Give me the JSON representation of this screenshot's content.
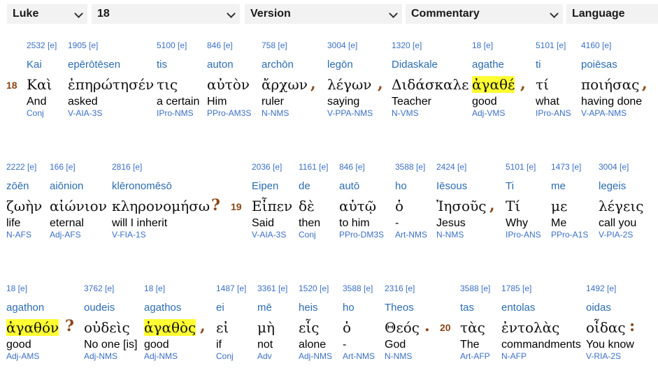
{
  "toolbar": {
    "book": "Luke",
    "chapter": "18",
    "version": "Version",
    "commentary": "Commentary",
    "language": "Language"
  },
  "verses": {
    "v18": "18",
    "v19": "19",
    "v20": "20"
  },
  "punctuation": {
    "p1": ",",
    "p2": ",",
    "p3": ",",
    "p4": ",",
    "p5": "?",
    "p6": ",",
    "p7": "?",
    "p8": ",",
    "p9": ".",
    "p10": ":"
  },
  "words": [
    {
      "strong": "2532 [e]",
      "translit": "Kai",
      "greek": "Καὶ",
      "english": "And",
      "morph": "Conj"
    },
    {
      "strong": "1905 [e]",
      "translit": "epērōtēsen",
      "greek": "ἐπηρώτησέν",
      "english": "asked",
      "morph": "V-AIA-3S"
    },
    {
      "strong": "5100 [e]",
      "translit": "tis",
      "greek": "τις",
      "english": "a certain",
      "morph": "IPro-NMS"
    },
    {
      "strong": "846 [e]",
      "translit": "auton",
      "greek": "αὐτὸν",
      "english": "Him",
      "morph": "PPro-AM3S"
    },
    {
      "strong": "758 [e]",
      "translit": "archōn",
      "greek": "ἄρχων",
      "english": "ruler",
      "morph": "N-NMS"
    },
    {
      "strong": "3004 [e]",
      "translit": "legōn",
      "greek": "λέγων",
      "english": "saying",
      "morph": "V-PPA-NMS"
    },
    {
      "strong": "1320 [e]",
      "translit": "Didaskale",
      "greek": "Διδάσκαλε",
      "english": "Teacher",
      "morph": "N-VMS"
    },
    {
      "strong": "18 [e]",
      "translit": "agathe",
      "greek": "ἀγαθέ",
      "english": "good",
      "morph": "Adj-VMS",
      "highlight": true
    },
    {
      "strong": "5101 [e]",
      "translit": "ti",
      "greek": "τί",
      "english": "what",
      "morph": "IPro-ANS"
    },
    {
      "strong": "4160 [e]",
      "translit": "poiēsas",
      "greek": "ποιήσας",
      "english": "having done",
      "morph": "V-APA-NMS"
    },
    {
      "strong": "2222 [e]",
      "translit": "zōēn",
      "greek": "ζωὴν",
      "english": "life",
      "morph": "N-AFS"
    },
    {
      "strong": "166 [e]",
      "translit": "aiōnion",
      "greek": "αἰώνιον",
      "english": "eternal",
      "morph": "Adj-AFS"
    },
    {
      "strong": "2816 [e]",
      "translit": "klēronomēsō",
      "greek": "κληρονομήσω",
      "english": "will I inherit",
      "morph": "V-FIA-1S"
    },
    {
      "strong": "2036 [e]",
      "translit": "Eipen",
      "greek": "Εἶπεν",
      "english": "Said",
      "morph": "V-AIA-3S"
    },
    {
      "strong": "1161 [e]",
      "translit": "de",
      "greek": "δὲ",
      "english": "then",
      "morph": "Conj"
    },
    {
      "strong": "846 [e]",
      "translit": "autō",
      "greek": "αὐτῷ",
      "english": "to him",
      "morph": "PPro-DM3S"
    },
    {
      "strong": "3588 [e]",
      "translit": "ho",
      "greek": "ὁ",
      "english": "-",
      "morph": "Art-NMS"
    },
    {
      "strong": "2424 [e]",
      "translit": "Iēsous",
      "greek": "Ἰησοῦς",
      "english": "Jesus",
      "morph": "N-NMS"
    },
    {
      "strong": "5101 [e]",
      "translit": "Ti",
      "greek": "Τί",
      "english": "Why",
      "morph": "IPro-ANS"
    },
    {
      "strong": "1473 [e]",
      "translit": "me",
      "greek": "με",
      "english": "Me",
      "morph": "PPro-A1S"
    },
    {
      "strong": "3004 [e]",
      "translit": "legeis",
      "greek": "λέγεις",
      "english": "call you",
      "morph": "V-PIA-2S"
    },
    {
      "strong": "18 [e]",
      "translit": "agathon",
      "greek": "ἀγαθόν",
      "english": "good",
      "morph": "Adj-AMS",
      "highlight": true
    },
    {
      "strong": "3762 [e]",
      "translit": "oudeis",
      "greek": "οὐδεὶς",
      "english": "No one [is]",
      "morph": "Adj-NMS"
    },
    {
      "strong": "18 [e]",
      "translit": "agathos",
      "greek": "ἀγαθὸς",
      "english": "good",
      "morph": "Adj-NMS",
      "highlight": true
    },
    {
      "strong": "1487 [e]",
      "translit": "ei",
      "greek": "εἰ",
      "english": "if",
      "morph": "Conj"
    },
    {
      "strong": "3361 [e]",
      "translit": "mē",
      "greek": "μὴ",
      "english": "not",
      "morph": "Adv"
    },
    {
      "strong": "1520 [e]",
      "translit": "heis",
      "greek": "εἷς",
      "english": "alone",
      "morph": "Adj-NMS"
    },
    {
      "strong": "3588 [e]",
      "translit": "ho",
      "greek": "ὁ",
      "english": "-",
      "morph": "Art-NMS"
    },
    {
      "strong": "2316 [e]",
      "translit": "Theos",
      "greek": "Θεός",
      "english": "God",
      "morph": "N-NMS"
    },
    {
      "strong": "3588 [e]",
      "translit": "tas",
      "greek": "τὰς",
      "english": "The",
      "morph": "Art-AFP"
    },
    {
      "strong": "1785 [e]",
      "translit": "entolas",
      "greek": "ἐντολὰς",
      "english": "commandments",
      "morph": "N-AFP"
    },
    {
      "strong": "1492 [e]",
      "translit": "oidas",
      "greek": "οἶδας",
      "english": "You know",
      "morph": "V-RIA-2S"
    }
  ]
}
